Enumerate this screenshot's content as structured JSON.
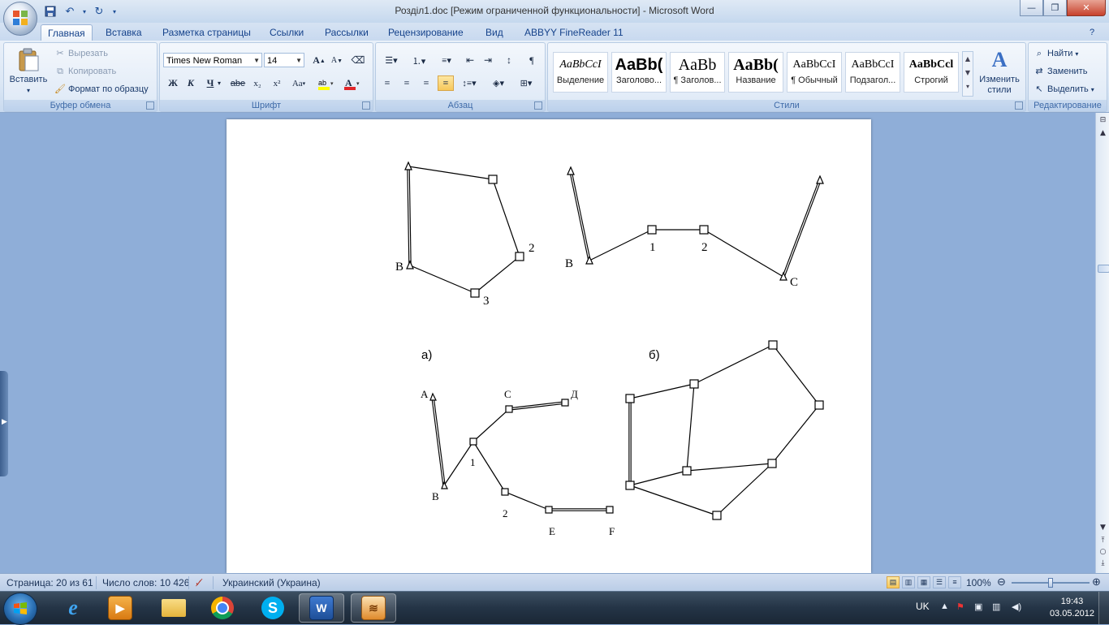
{
  "window": {
    "title": "Розділ1.doc [Режим ограниченной функциональности] - Microsoft Word"
  },
  "tabs": [
    "Главная",
    "Вставка",
    "Разметка страницы",
    "Ссылки",
    "Рассылки",
    "Рецензирование",
    "Вид",
    "ABBYY FineReader 11"
  ],
  "active_tab": "Главная",
  "clipboard": {
    "paste": "Вставить",
    "cut": "Вырезать",
    "copy": "Копировать",
    "format_painter": "Формат по образцу",
    "label": "Буфер обмена"
  },
  "font": {
    "name": "Times New Roman",
    "size": "14",
    "label": "Шрифт",
    "bold": "Ж",
    "italic": "К",
    "underline": "Ч",
    "strike": "abe",
    "subscript": "x₂",
    "superscript": "x²",
    "change_case": "Aa",
    "grow": "A",
    "shrink": "A"
  },
  "paragraph": {
    "label": "Абзац",
    "pilcrow": "¶"
  },
  "styles": {
    "label": "Стили",
    "items": [
      {
        "sample": "AaBbCcI",
        "name": "Выделение"
      },
      {
        "sample": "AaBb(",
        "name": "Заголово..."
      },
      {
        "sample": "AaBb",
        "name": "¶ Заголов..."
      },
      {
        "sample": "AaBb(",
        "name": "Название"
      },
      {
        "sample": "AaBbCcI",
        "name": "¶ Обычный"
      },
      {
        "sample": "AaBbCcI",
        "name": "Подзагол..."
      },
      {
        "sample": "AaBbCcl",
        "name": "Строгий"
      }
    ],
    "change_styles": "Изменить стили"
  },
  "editing": {
    "label": "Редактирование",
    "find": "Найти",
    "replace": "Заменить",
    "select": "Выделить"
  },
  "figure": {
    "labels": {
      "a": "а)",
      "b": "б)",
      "fig1_2": "2",
      "fig1_3": "3",
      "fig1_B": "В",
      "fig2_B": "В",
      "fig2_1": "1",
      "fig2_2": "2",
      "fig2_C": "С",
      "fig3_A": "А",
      "fig3_B": "В",
      "fig3_C": "С",
      "fig3_D": "Д",
      "fig3_1": "1",
      "fig3_2": "2",
      "fig3_E": "E",
      "fig3_F": "F"
    }
  },
  "status": {
    "page": "Страница: 20 из 61",
    "words": "Число слов: 10 426",
    "language": "Украинский (Украина)",
    "zoom": "100%",
    "zoom_level": 1.0
  },
  "taskbar": {
    "lang": "UK",
    "time": "19:43",
    "date": "03.05.2012"
  }
}
